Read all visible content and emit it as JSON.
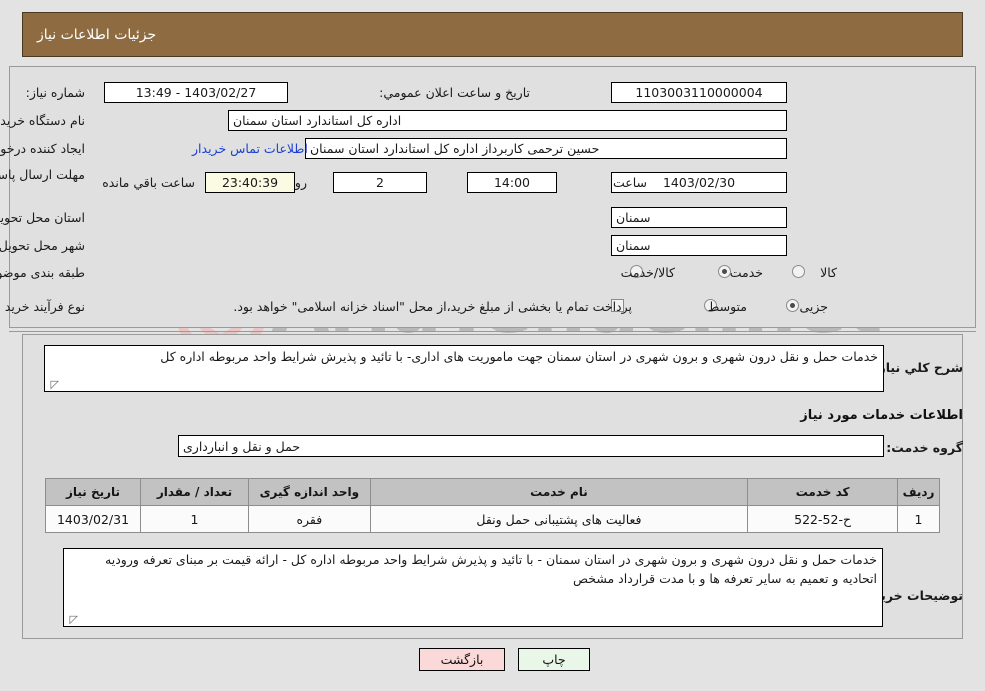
{
  "window": {
    "title": "جزئیات اطلاعات نیاز"
  },
  "watermark": {
    "text": "AriaTender.net",
    "shield_color": "#e8c3c3"
  },
  "top_form": {
    "need_number_label": "شماره نیاز:",
    "need_number_value": "1103003110000004",
    "public_announce_label": "تاریخ و ساعت اعلان عمومي:",
    "public_announce_value": "1403/02/27 - 13:49",
    "buyer_org_label": "نام دستگاه خریدار:",
    "buyer_org_value": "اداره کل استاندارد استان سمنان",
    "creator_label": "ایجاد کننده درخواست:",
    "creator_value": "حسین ترحمی کاربرداز اداره کل استاندارد استان سمنان",
    "contact_link": "اطلاعات تماس خریدار",
    "deadline_label": "مهلت ارسال پاسخ: تا تاریخ:",
    "deadline_date": "1403/02/30",
    "hour_label": "ساعت",
    "deadline_time": "14:00",
    "days_value": "2",
    "days_label": "روز و",
    "countdown_value": "23:40:39",
    "remaining_label": "ساعت باقي مانده",
    "province_label": "استان محل تحویل:",
    "province_value": "سمنان",
    "city_label": "شهر محل تحویل:",
    "city_value": "سمنان",
    "category_label": "طبقه بندی موضوعی:",
    "category_options": [
      {
        "label": "کالا",
        "selected": false
      },
      {
        "label": "خدمت",
        "selected": true
      },
      {
        "label": "کالا/خدمت",
        "selected": false
      }
    ],
    "process_label": "نوع فرآیند خرید :",
    "process_options": [
      {
        "label": "جزیی",
        "selected": true
      },
      {
        "label": "متوسط",
        "selected": false
      }
    ],
    "treasury_checkbox_checked": false,
    "treasury_note": "پرداخت تمام یا بخشی از مبلغ خرید،از محل \"اسناد خزانه اسلامی\" خواهد بود."
  },
  "middle": {
    "summary_label": "شرح کلي نیاز:",
    "summary_value": "خدمات حمل و نقل درون شهری و برون شهری در استان سمنان جهت ماموریت های اداری- با تائید و پذیرش شرایط واحد مربوطه اداره کل",
    "section_heading": "اطلاعات خدمات مورد نیاز",
    "service_group_label": "گروه خدمت:",
    "service_group_value": "حمل و نقل و انبارداری"
  },
  "table": {
    "headers": [
      "ردیف",
      "کد خدمت",
      "نام خدمت",
      "واحد اندازه گیری",
      "تعداد / مقدار",
      "تاریخ نیاز"
    ],
    "rows": [
      {
        "row_no": "1",
        "service_code": "ح-52-522",
        "service_name": "فعالیت های پشتیبانی حمل ونقل",
        "unit": "فقره",
        "quantity": "1",
        "need_date": "1403/02/31"
      }
    ]
  },
  "notes": {
    "label": "توضیحات خریدار:",
    "value": "خدمات حمل و نقل درون شهری و برون شهری در استان سمنان  - با تائید و پذیرش شرایط واحد مربوطه اداره کل - ارائه قیمت بر مبنای تعرفه ورودیه اتحادیه و تعمیم به سایر تعرفه ها و با مدت قرارداد مشخص"
  },
  "footer": {
    "print_label": "چاپ",
    "back_label": "بازگشت"
  }
}
